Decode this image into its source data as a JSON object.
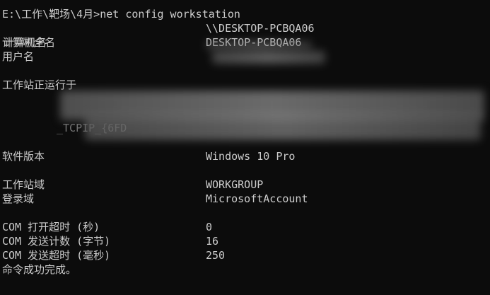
{
  "prompt_line": "E:\\工作\\靶场\\4月>net config workstation",
  "rows": [
    {
      "label": "计算机名",
      "value": "\\\\DESKTOP-PCBQA06"
    },
    {
      "label": "计算机全名",
      "value": "DESKTOP-PCBQA06"
    },
    {
      "label": "用户名",
      "value": ""
    },
    {
      "label": "工作站正运行于",
      "value": ""
    },
    {
      "label": "软件版本",
      "value": "Windows 10 Pro"
    },
    {
      "label": "工作站域",
      "value": "WORKGROUP"
    },
    {
      "label": "登录域",
      "value": "MicrosoftAccount"
    },
    {
      "label": "COM 打开超时 (秒)",
      "value": "0"
    },
    {
      "label": "COM 发送计数 (字节)",
      "value": "16"
    },
    {
      "label": "COM 发送超时 (毫秒)",
      "value": "250"
    }
  ],
  "partial_text": "_TCPIP_{6FD",
  "completion": "命令成功完成。"
}
